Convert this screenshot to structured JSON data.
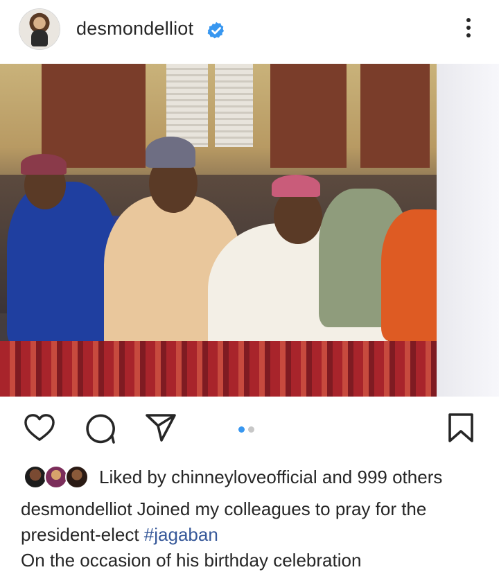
{
  "post": {
    "username": "desmondelliot",
    "verified": true,
    "likes": {
      "prefix": "Liked by",
      "user": "chinneyloveofficial",
      "and": "and",
      "others": "999 others"
    },
    "caption": {
      "username": "desmondelliot",
      "line1": "Joined my colleagues to pray for the",
      "line2_prefix": "president-elect",
      "hashtag": "#jagaban",
      "line3": "On the occasion of his birthday celebration"
    },
    "carousel": {
      "total": 2,
      "active": 1
    }
  },
  "icons": {
    "more": "more-vertical-icon",
    "like": "heart-icon",
    "comment": "comment-icon",
    "share": "send-icon",
    "save": "bookmark-icon",
    "verified": "verified-badge-icon"
  },
  "colors": {
    "verified_blue": "#3897f0",
    "carousel_active": "#3897f0",
    "carousel_inactive": "#c7c7c7",
    "hashtag": "#365899",
    "text": "#262626"
  }
}
